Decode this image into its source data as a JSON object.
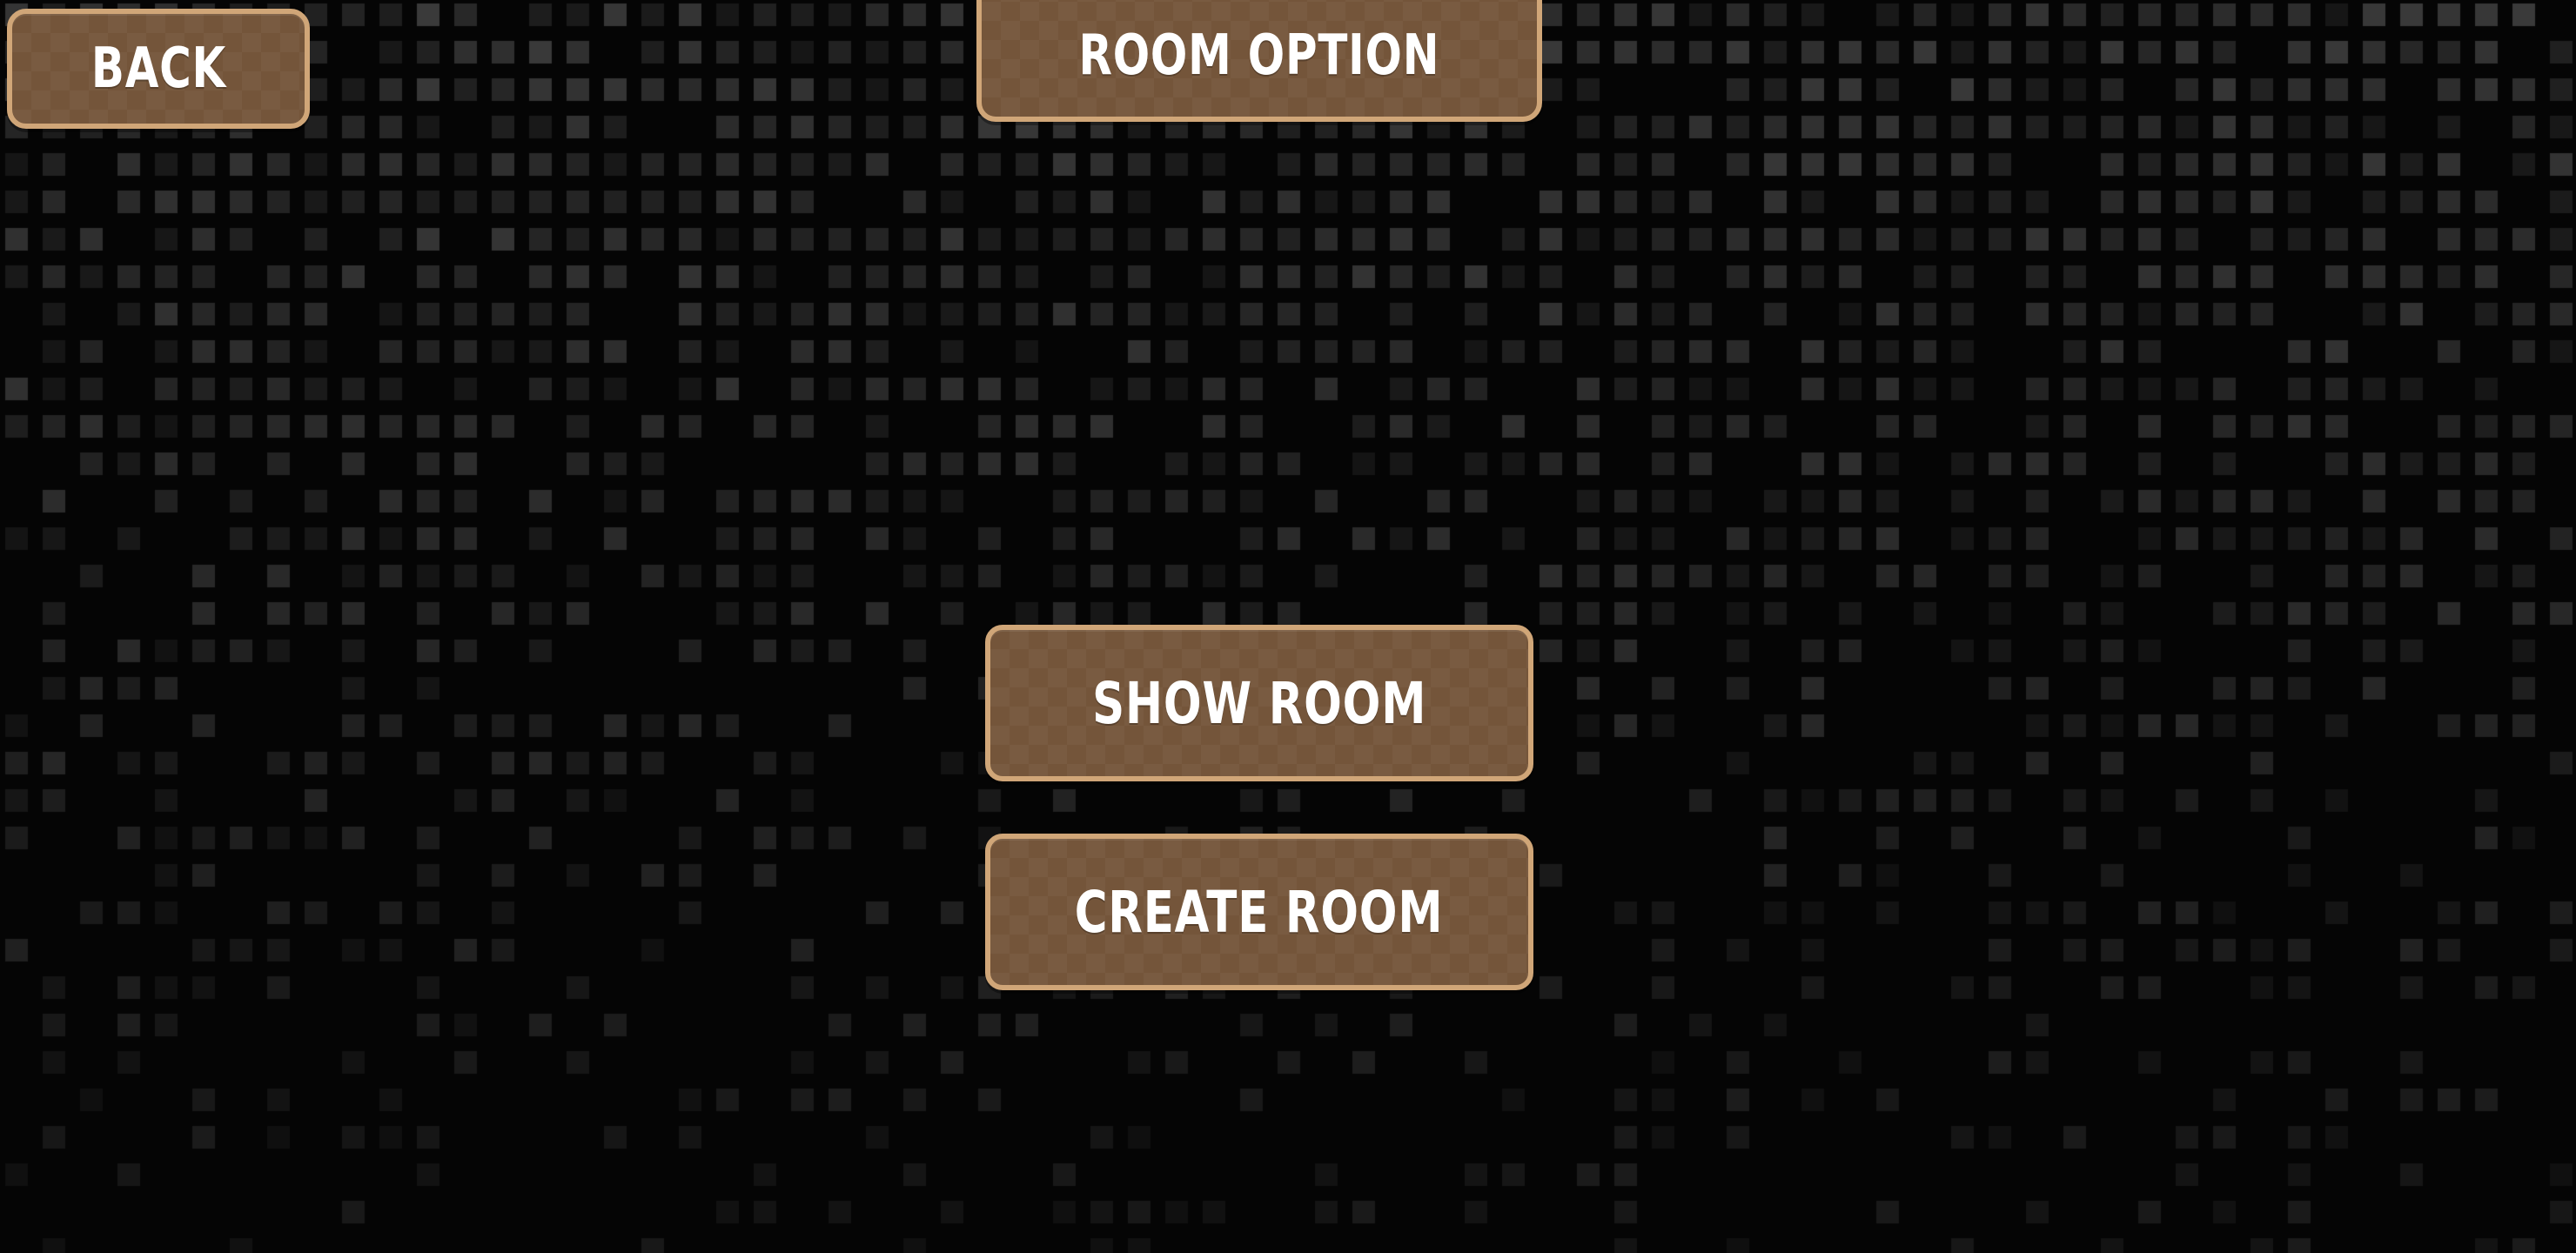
{
  "header": {
    "back_label": "BACK",
    "title": "ROOM OPTION"
  },
  "menu": {
    "show_room_label": "SHOW ROOM",
    "create_room_label": "CREATE ROOM"
  },
  "colors": {
    "background": "#050505",
    "button_fill": "#74553a",
    "button_border": "#d0a678",
    "button_text": "#ffffff",
    "grid_tile": "#2a2a2a"
  }
}
